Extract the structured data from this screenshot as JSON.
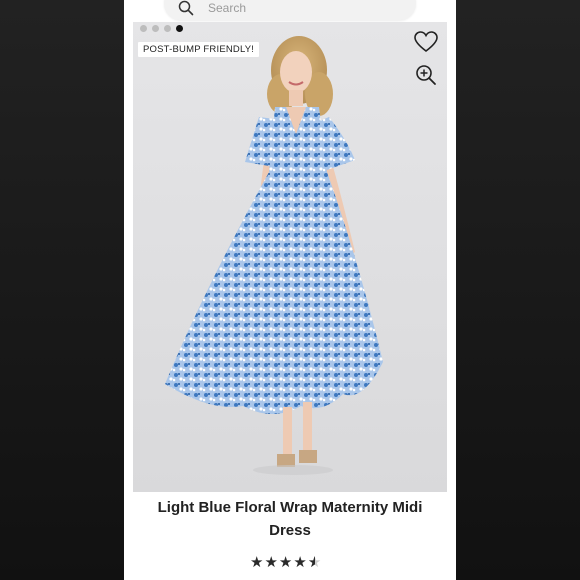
{
  "search": {
    "placeholder": "Search"
  },
  "gallery": {
    "dot_count": 4,
    "active_index": 3
  },
  "product": {
    "badge": "POST-BUMP FRIENDLY!",
    "title": "Light Blue Floral Wrap Maternity Midi Dress",
    "rating": 4.5,
    "rating_max": 5
  },
  "icons": {
    "search": "search-icon",
    "like": "heart-icon",
    "zoom": "zoom-in-icon"
  },
  "colors": {
    "dress": "#8fb4e0",
    "dress_pattern": "#2f6db5",
    "background": "#e3e3e5",
    "text": "#222222"
  }
}
